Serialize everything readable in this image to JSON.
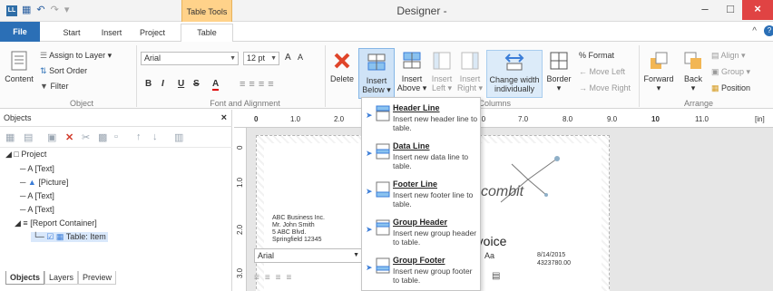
{
  "titlebar": {
    "app_icon": "LL",
    "qat_icons": [
      "save-icon",
      "undo-icon",
      "redo-icon",
      "customize-icon"
    ],
    "context_tab_header": "Table Tools",
    "window_title": "Designer -",
    "min_glyph": "–",
    "max_glyph": "□",
    "close_glyph": "×"
  },
  "tabs": {
    "file": "File",
    "start": "Start",
    "insert": "Insert",
    "project": "Project",
    "table": "Table",
    "collapse_glyph": "^",
    "help_glyph": "?"
  },
  "ribbon": {
    "content_label": "Content",
    "assign_layer": "Assign to Layer",
    "sort_order": "Sort Order",
    "filter": "Filter",
    "object_group": "Object",
    "font_name": "Arial",
    "font_size": "12 pt",
    "grow_font": "A",
    "shrink_font": "A",
    "bold": "B",
    "italic": "I",
    "underline": "U",
    "strike": "S",
    "font_color": "A",
    "font_group": "Font and Alignment",
    "delete": "Delete",
    "insert_below": "Insert",
    "insert_below2": "Below",
    "insert_above": "Insert",
    "insert_above2": "Above",
    "insert_left": "Insert",
    "insert_left2": "Left",
    "insert_right": "Insert",
    "insert_right2": "Right",
    "change_width": "Change width",
    "change_width2": "individually",
    "border": "Border",
    "columns_group": "d Columns",
    "format": "% Format",
    "move_left": "Move Left",
    "move_right": "Move Right",
    "forward": "Forward",
    "back": "Back",
    "align": "Align",
    "group": "Group",
    "position": "Position",
    "arrange_group": "Arrange"
  },
  "objects_pane": {
    "title": "Objects",
    "close": "×",
    "tree": [
      {
        "label": "Project",
        "indent": 0
      },
      {
        "label": "A  [Text]",
        "indent": 1
      },
      {
        "label": "[Picture]",
        "indent": 1
      },
      {
        "label": "A  [Text]",
        "indent": 1
      },
      {
        "label": "A  [Text]",
        "indent": 1
      },
      {
        "label": "[Report Container]",
        "indent": 1
      },
      {
        "label": "Table: Item",
        "indent": 2
      }
    ],
    "bottom_tabs": [
      "Objects",
      "Layers",
      "Preview"
    ]
  },
  "ruler": {
    "h_ticks": [
      "0",
      "1.0",
      "2.0",
      "6.0",
      "7.0",
      "8.0",
      "9.0",
      "10",
      "11.0",
      "[in]"
    ],
    "v_ticks": [
      "0",
      "1.0",
      "2.0",
      "3.0"
    ]
  },
  "canvas": {
    "address_lines": [
      "ABC Business Inc.",
      "Mr. John Smith",
      "5 ABC Blvd.",
      "Springfield 12345"
    ],
    "logo_text": "combit",
    "invoice_title": "Invoice",
    "date": "8/14/2015",
    "number": "4323780.00",
    "mini_font": "Arial",
    "mini_aa": "Aa"
  },
  "insert_menu": {
    "items": [
      {
        "title": "Header Line",
        "desc": "Insert new header line to table."
      },
      {
        "title": "Data Line",
        "desc": "Insert new data line to table."
      },
      {
        "title": "Footer Line",
        "desc": "Insert new footer line to table."
      },
      {
        "title": "Group Header",
        "desc": "Insert new group header to table."
      },
      {
        "title": "Group Footer",
        "desc": "Insert new group footer to table."
      }
    ]
  },
  "colors": {
    "file_tab": "#2b6fb6",
    "context_tab": "#ffd28a",
    "close_button": "#e04343",
    "selection": "#cfe3f7"
  }
}
